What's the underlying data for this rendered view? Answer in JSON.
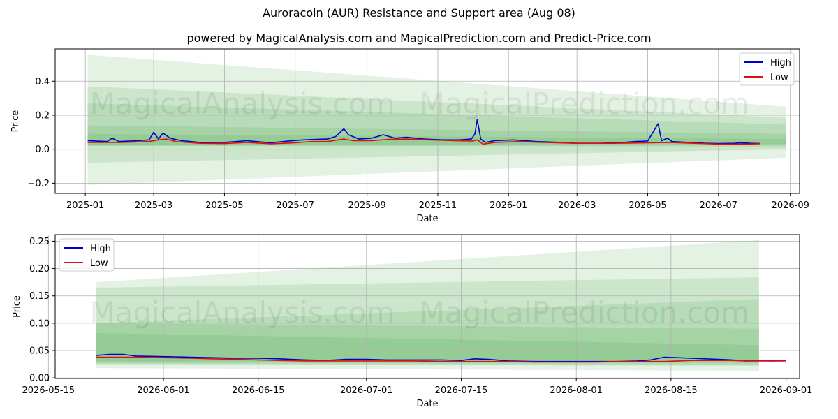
{
  "title": "Auroracoin (AUR) Resistance and Support area (Aug 08)",
  "subtitle": "powered by MagicalAnalysis.com and MagicalPrediction.com and Predict-Price.com",
  "watermarks": [
    "MagicalAnalysis.com",
    "MagicalPrediction.com"
  ],
  "colors": {
    "high": "#0000cc",
    "low": "#dd1111",
    "band": "#2e9a2e",
    "grid": "#b0b0b0"
  },
  "chart_data": [
    {
      "type": "line",
      "xlabel": "Date",
      "ylabel": "Price",
      "xlim": [
        "2024-12-06",
        "2026-09-09"
      ],
      "ylim": [
        -0.26,
        0.59
      ],
      "x_ticks": [
        "2025-01",
        "2025-03",
        "2025-05",
        "2025-07",
        "2025-09",
        "2025-11",
        "2026-01",
        "2026-03",
        "2026-05",
        "2026-07",
        "2026-09"
      ],
      "y_ticks": [
        -0.2,
        0.0,
        0.2,
        0.4
      ],
      "y_tick_labels": [
        "−0.2",
        "0.0",
        "0.2",
        "0.4"
      ],
      "grid": true,
      "legend": "upper right",
      "series": [
        {
          "name": "High",
          "color": "#0000cc",
          "points": [
            [
              "2025-01-03",
              0.05
            ],
            [
              "2025-01-20",
              0.045
            ],
            [
              "2025-01-24",
              0.065
            ],
            [
              "2025-01-30",
              0.045
            ],
            [
              "2025-02-15",
              0.05
            ],
            [
              "2025-02-25",
              0.055
            ],
            [
              "2025-03-01",
              0.1
            ],
            [
              "2025-03-05",
              0.06
            ],
            [
              "2025-03-09",
              0.095
            ],
            [
              "2025-03-12",
              0.08
            ],
            [
              "2025-03-15",
              0.065
            ],
            [
              "2025-03-25",
              0.05
            ],
            [
              "2025-04-10",
              0.04
            ],
            [
              "2025-05-01",
              0.04
            ],
            [
              "2025-05-20",
              0.05
            ],
            [
              "2025-06-10",
              0.038
            ],
            [
              "2025-06-25",
              0.048
            ],
            [
              "2025-07-08",
              0.055
            ],
            [
              "2025-07-20",
              0.058
            ],
            [
              "2025-07-29",
              0.06
            ],
            [
              "2025-08-05",
              0.075
            ],
            [
              "2025-08-12",
              0.12
            ],
            [
              "2025-08-16",
              0.085
            ],
            [
              "2025-08-25",
              0.06
            ],
            [
              "2025-09-05",
              0.065
            ],
            [
              "2025-09-15",
              0.085
            ],
            [
              "2025-09-25",
              0.065
            ],
            [
              "2025-10-05",
              0.07
            ],
            [
              "2025-10-20",
              0.06
            ],
            [
              "2025-11-05",
              0.055
            ],
            [
              "2025-11-20",
              0.055
            ],
            [
              "2025-11-30",
              0.06
            ],
            [
              "2025-12-03",
              0.09
            ],
            [
              "2025-12-05",
              0.175
            ],
            [
              "2025-12-08",
              0.06
            ],
            [
              "2025-12-12",
              0.04
            ],
            [
              "2025-12-20",
              0.05
            ],
            [
              "2026-01-05",
              0.055
            ],
            [
              "2026-01-25",
              0.045
            ],
            [
              "2026-02-15",
              0.04
            ],
            [
              "2026-03-01",
              0.035
            ],
            [
              "2026-03-20",
              0.035
            ],
            [
              "2026-04-10",
              0.04
            ],
            [
              "2026-04-20",
              0.045
            ],
            [
              "2026-05-01",
              0.048
            ],
            [
              "2026-05-10",
              0.15
            ],
            [
              "2026-05-13",
              0.05
            ],
            [
              "2026-05-18",
              0.065
            ],
            [
              "2026-05-22",
              0.045
            ],
            [
              "2026-06-05",
              0.04
            ],
            [
              "2026-06-20",
              0.035
            ],
            [
              "2026-07-01",
              0.033
            ],
            [
              "2026-07-15",
              0.035
            ],
            [
              "2026-07-20",
              0.038
            ],
            [
              "2026-07-29",
              0.035
            ],
            [
              "2026-08-06",
              0.033
            ]
          ]
        },
        {
          "name": "Low",
          "color": "#dd1111",
          "points": [
            [
              "2025-01-03",
              0.04
            ],
            [
              "2025-02-01",
              0.04
            ],
            [
              "2025-02-25",
              0.045
            ],
            [
              "2025-03-05",
              0.055
            ],
            [
              "2025-03-12",
              0.06
            ],
            [
              "2025-03-20",
              0.045
            ],
            [
              "2025-04-10",
              0.035
            ],
            [
              "2025-05-01",
              0.033
            ],
            [
              "2025-05-20",
              0.04
            ],
            [
              "2025-06-10",
              0.032
            ],
            [
              "2025-07-01",
              0.038
            ],
            [
              "2025-07-15",
              0.045
            ],
            [
              "2025-07-29",
              0.045
            ],
            [
              "2025-08-12",
              0.06
            ],
            [
              "2025-08-20",
              0.05
            ],
            [
              "2025-09-05",
              0.05
            ],
            [
              "2025-09-20",
              0.058
            ],
            [
              "2025-10-05",
              0.06
            ],
            [
              "2025-10-25",
              0.055
            ],
            [
              "2025-11-15",
              0.05
            ],
            [
              "2025-12-01",
              0.048
            ],
            [
              "2025-12-05",
              0.055
            ],
            [
              "2025-12-10",
              0.03
            ],
            [
              "2025-12-20",
              0.04
            ],
            [
              "2026-01-10",
              0.045
            ],
            [
              "2026-02-01",
              0.04
            ],
            [
              "2026-03-01",
              0.035
            ],
            [
              "2026-04-01",
              0.035
            ],
            [
              "2026-05-01",
              0.038
            ],
            [
              "2026-05-20",
              0.04
            ],
            [
              "2026-06-10",
              0.035
            ],
            [
              "2026-07-01",
              0.03
            ],
            [
              "2026-07-20",
              0.03
            ],
            [
              "2026-08-06",
              0.032
            ]
          ]
        }
      ],
      "bands": [
        {
          "start": "2025-01-03",
          "end": "2026-08-28",
          "top": [
            0.555,
            0.25
          ],
          "bottom": [
            -0.21,
            -0.05
          ]
        },
        {
          "start": "2025-01-03",
          "end": "2026-08-28",
          "top": [
            0.37,
            0.185
          ],
          "bottom": [
            -0.08,
            0.0
          ]
        },
        {
          "start": "2025-01-03",
          "end": "2026-08-28",
          "top": [
            0.27,
            0.145
          ],
          "bottom": [
            0.02,
            0.015
          ]
        },
        {
          "start": "2025-01-03",
          "end": "2026-08-28",
          "top": [
            0.14,
            0.09
          ],
          "bottom": [
            0.02,
            0.025
          ]
        },
        {
          "start": "2025-01-03",
          "end": "2026-08-28",
          "top": [
            0.09,
            0.06
          ],
          "bottom": [
            0.025,
            0.03
          ]
        }
      ]
    },
    {
      "type": "line",
      "xlabel": "Date",
      "ylabel": "Price",
      "xlim": [
        "2026-05-16",
        "2026-09-03"
      ],
      "ylim": [
        -0.001,
        0.262
      ],
      "x_ticks": [
        "2026-05-15",
        "2026-06-01",
        "2026-06-15",
        "2026-07-01",
        "2026-07-15",
        "2026-08-01",
        "2026-08-15",
        "2026-09-01"
      ],
      "y_ticks": [
        0.0,
        0.05,
        0.1,
        0.15,
        0.2,
        0.25
      ],
      "y_tick_labels": [
        "0.00",
        "0.05",
        "0.10",
        "0.15",
        "0.20",
        "0.25"
      ],
      "grid": true,
      "legend": "upper left",
      "series": [
        {
          "name": "High",
          "color": "#0000cc",
          "points": [
            [
              "2026-05-22",
              0.041
            ],
            [
              "2026-05-24",
              0.043
            ],
            [
              "2026-05-26",
              0.043
            ],
            [
              "2026-05-28",
              0.04
            ],
            [
              "2026-06-01",
              0.039
            ],
            [
              "2026-06-05",
              0.038
            ],
            [
              "2026-06-08",
              0.037
            ],
            [
              "2026-06-12",
              0.036
            ],
            [
              "2026-06-15",
              0.036
            ],
            [
              "2026-06-18",
              0.035
            ],
            [
              "2026-06-22",
              0.033
            ],
            [
              "2026-06-25",
              0.032
            ],
            [
              "2026-06-28",
              0.034
            ],
            [
              "2026-07-01",
              0.034
            ],
            [
              "2026-07-04",
              0.033
            ],
            [
              "2026-07-08",
              0.033
            ],
            [
              "2026-07-12",
              0.033
            ],
            [
              "2026-07-15",
              0.032
            ],
            [
              "2026-07-17",
              0.035
            ],
            [
              "2026-07-19",
              0.034
            ],
            [
              "2026-07-22",
              0.031
            ],
            [
              "2026-07-26",
              0.03
            ],
            [
              "2026-07-30",
              0.03
            ],
            [
              "2026-08-02",
              0.03
            ],
            [
              "2026-08-04",
              0.03
            ],
            [
              "2026-08-07",
              0.03
            ],
            [
              "2026-08-10",
              0.031
            ],
            [
              "2026-08-12",
              0.033
            ],
            [
              "2026-08-14",
              0.038
            ],
            [
              "2026-08-16",
              0.037
            ],
            [
              "2026-08-18",
              0.036
            ],
            [
              "2026-08-20",
              0.035
            ],
            [
              "2026-08-22",
              0.034
            ],
            [
              "2026-08-24",
              0.033
            ],
            [
              "2026-08-26",
              0.031
            ],
            [
              "2026-08-28",
              0.032
            ],
            [
              "2026-08-30",
              0.031
            ],
            [
              "2026-09-01",
              0.032
            ]
          ]
        },
        {
          "name": "Low",
          "color": "#dd1111",
          "points": [
            [
              "2026-05-22",
              0.038
            ],
            [
              "2026-05-24",
              0.038
            ],
            [
              "2026-05-26",
              0.038
            ],
            [
              "2026-05-28",
              0.038
            ],
            [
              "2026-06-01",
              0.037
            ],
            [
              "2026-06-05",
              0.036
            ],
            [
              "2026-06-08",
              0.035
            ],
            [
              "2026-06-12",
              0.034
            ],
            [
              "2026-06-15",
              0.033
            ],
            [
              "2026-06-18",
              0.032
            ],
            [
              "2026-06-22",
              0.031
            ],
            [
              "2026-06-25",
              0.031
            ],
            [
              "2026-06-28",
              0.031
            ],
            [
              "2026-07-01",
              0.031
            ],
            [
              "2026-07-04",
              0.031
            ],
            [
              "2026-07-08",
              0.031
            ],
            [
              "2026-07-12",
              0.03
            ],
            [
              "2026-07-15",
              0.03
            ],
            [
              "2026-07-17",
              0.03
            ],
            [
              "2026-07-19",
              0.03
            ],
            [
              "2026-07-22",
              0.03
            ],
            [
              "2026-07-26",
              0.029
            ],
            [
              "2026-07-30",
              0.029
            ],
            [
              "2026-08-02",
              0.029
            ],
            [
              "2026-08-04",
              0.029
            ],
            [
              "2026-08-07",
              0.03
            ],
            [
              "2026-08-10",
              0.03
            ],
            [
              "2026-08-12",
              0.03
            ],
            [
              "2026-08-14",
              0.03
            ],
            [
              "2026-08-16",
              0.031
            ],
            [
              "2026-08-18",
              0.032
            ],
            [
              "2026-08-20",
              0.032
            ],
            [
              "2026-08-22",
              0.032
            ],
            [
              "2026-08-24",
              0.032
            ],
            [
              "2026-08-26",
              0.031
            ],
            [
              "2026-08-28",
              0.031
            ],
            [
              "2026-08-30",
              0.031
            ],
            [
              "2026-09-01",
              0.031
            ]
          ]
        }
      ],
      "bands": [
        {
          "start": "2026-05-22",
          "end": "2026-08-28",
          "top": [
            0.175,
            0.252
          ],
          "bottom": [
            0.018,
            0.013
          ]
        },
        {
          "start": "2026-05-22",
          "end": "2026-08-28",
          "top": [
            0.165,
            0.184
          ],
          "bottom": [
            0.025,
            0.022
          ]
        },
        {
          "start": "2026-05-22",
          "end": "2026-08-28",
          "top": [
            0.1,
            0.144
          ],
          "bottom": [
            0.026,
            0.024
          ]
        },
        {
          "start": "2026-05-22",
          "end": "2026-08-28",
          "top": [
            0.1,
            0.09
          ],
          "bottom": [
            0.028,
            0.027
          ]
        },
        {
          "start": "2026-05-22",
          "end": "2026-08-28",
          "top": [
            0.082,
            0.06
          ],
          "bottom": [
            0.03,
            0.03
          ]
        }
      ]
    }
  ]
}
